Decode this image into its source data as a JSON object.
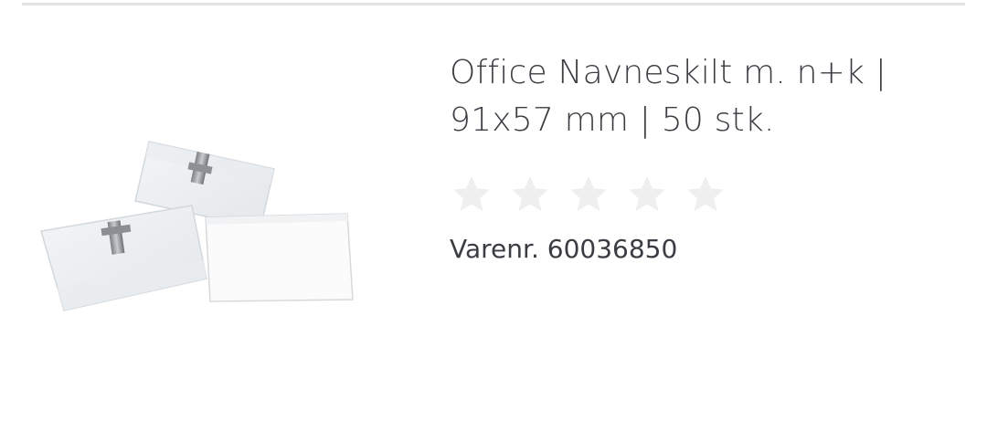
{
  "product": {
    "title_line1": "Office Navneskilt m. n+k |",
    "title_line2": "91x57 mm | 50 stk.",
    "rating": {
      "stars_total": 5,
      "stars_filled": 0,
      "empty_star_color": "#efefef"
    },
    "sku_label": "Varenr.",
    "sku_value": "60036850",
    "image_icon": "name-badge-product-image"
  },
  "colors": {
    "text": "#3a3d42",
    "divider": "#e4e4e4"
  }
}
